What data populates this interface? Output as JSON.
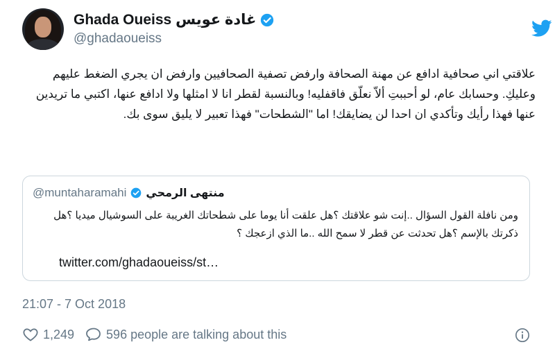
{
  "author": {
    "name": "Ghada Oueiss غادة عويس",
    "handle": "@ghadaoueiss"
  },
  "tweet": {
    "text": "علاقتي اني صحافية ادافع عن مهنة الصحافة وارفض تصفية الصحافيين وارفض ان يجري الضغط عليهم وعليكِ. وحسابك عام، لو أحببتِ ألاّ نعلّق فاقفليه! وبالنسبة لقطر انا لا امثلها ولا ادافع عنها، اكتبي ما تريدين عنها فهذا رأيك وتأكدي ان احدا لن يضايقك! اما \"الشطحات\" فهذا تعبير لا يليق سوى بك."
  },
  "quoted_tweet": {
    "name": "منتهى الرمحي",
    "handle": "@muntaharamahi",
    "text": "ومن نافلة القول السؤال ..إنت شو علاقتك ؟هل علقت أنا يوما على شطحاتك الغريبة على السوشيال ميديا ؟هل ذكرتك بالإسم ؟هل تحدثت عن قطر لا سمح الله ..ما الذي ازعجك ؟",
    "link": "twitter.com/ghadaoueiss/st…"
  },
  "timestamp": "21:07 - 7 Oct 2018",
  "actions": {
    "likes": "1,249",
    "talking": "596 people are talking about this"
  },
  "colors": {
    "brand_blue": "#1da1f2",
    "secondary_text": "#657786",
    "border": "#ccd6dd"
  },
  "icons": [
    "twitter-bird-icon",
    "verified-badge-icon",
    "heart-icon",
    "comment-icon",
    "info-icon"
  ]
}
